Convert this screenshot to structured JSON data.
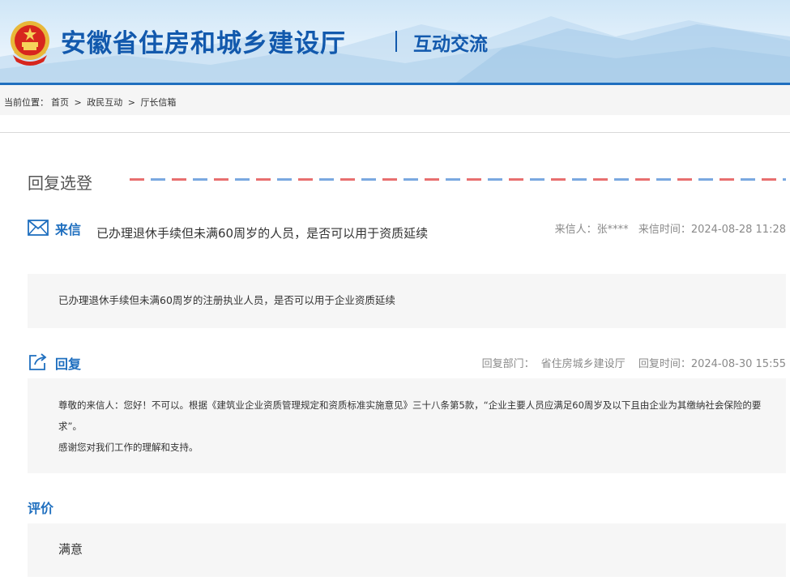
{
  "header": {
    "site_title": "安徽省住房和城乡建设厅",
    "section_title": "互动交流"
  },
  "breadcrumb": {
    "prefix": "当前位置：",
    "items": [
      "首页",
      "政民互动",
      "厅长信箱"
    ],
    "separator": ">"
  },
  "section": {
    "title": "回复选登"
  },
  "letter": {
    "label": "来信",
    "title": "已办理退休手续但未满60周岁的人员，是否可以用于资质延续",
    "sender_label": "来信人：",
    "sender": "张****",
    "time_label": "来信时间：",
    "time": "2024-08-28 11:28",
    "content": "已办理退休手续但未满60周岁的注册执业人员，是否可以用于企业资质延续"
  },
  "reply": {
    "label": "回复",
    "dept_label": "回复部门：",
    "dept": "省住房城乡建设厅",
    "time_label": "回复时间：",
    "time": "2024-08-30 15:55",
    "paragraph1": "尊敬的来信人：您好！不可以。根据《建筑业企业资质管理规定和资质标准实施意见》三十八条第5款，“企业主要人员应满足60周岁及以下且由企业为其缴纳社会保险的要求”。",
    "paragraph2": "感谢您对我们工作的理解和支持。"
  },
  "evaluation": {
    "label": "评价",
    "value": "满意"
  },
  "colors": {
    "brand_blue": "#1259ad",
    "label_blue": "#1f6fbf",
    "airmail_red": "#e86f6f",
    "airmail_blue": "#7aa8e0"
  },
  "icons": {
    "emblem": "national-emblem-icon",
    "letter": "envelope-icon",
    "reply": "share-reply-icon"
  }
}
